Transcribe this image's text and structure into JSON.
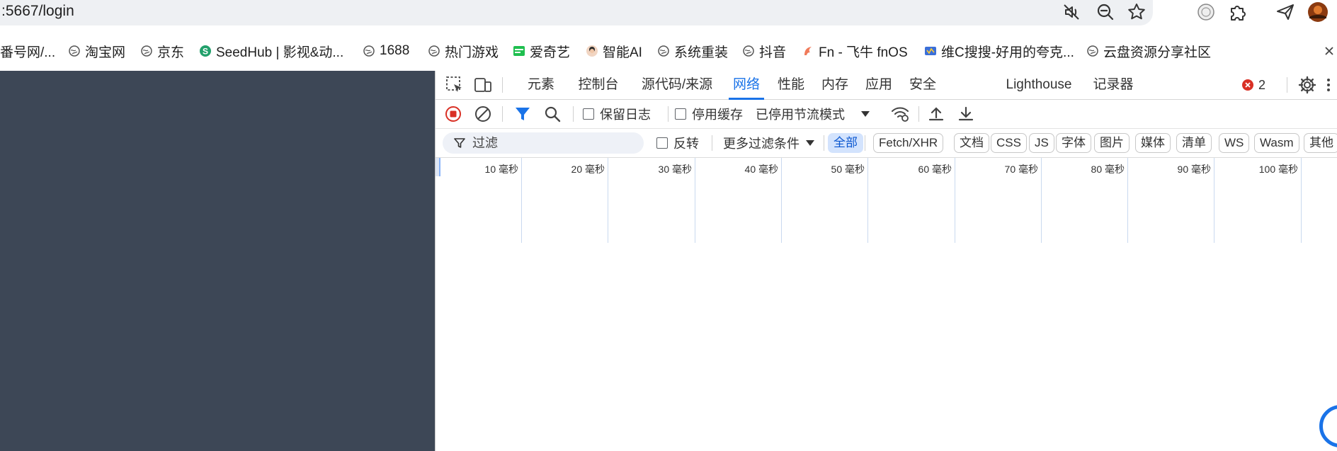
{
  "browser": {
    "url": ":5667/login"
  },
  "bookmarks": [
    {
      "label": "番号网/...",
      "icon": "none"
    },
    {
      "label": "淘宝网",
      "icon": "globe-icon"
    },
    {
      "label": "京东",
      "icon": "globe-icon"
    },
    {
      "label": "SeedHub | 影视&动...",
      "icon": "seedhub-logo-icon"
    },
    {
      "label": "1688",
      "icon": "globe-icon"
    },
    {
      "label": "热门游戏",
      "icon": "globe-icon"
    },
    {
      "label": "爱奇艺",
      "icon": "iqiyi-logo-icon"
    },
    {
      "label": "智能AI",
      "icon": "avatar-icon"
    },
    {
      "label": "系统重装",
      "icon": "globe-icon"
    },
    {
      "label": "抖音",
      "icon": "globe-icon"
    },
    {
      "label": "Fn - 飞牛 fnOS",
      "icon": "fnos-logo-icon"
    },
    {
      "label": "维C搜搜-好用的夸克...",
      "icon": "vc-logo-icon"
    },
    {
      "label": "云盘资源分享社区",
      "icon": "globe-icon"
    }
  ],
  "devtools": {
    "tabs": [
      "元素",
      "控制台",
      "源代码/来源",
      "网络",
      "性能",
      "内存",
      "应用",
      "安全",
      "Lighthouse",
      "记录器"
    ],
    "active_tab": "网络",
    "error_count": "2",
    "toolbar": {
      "preserve_log": "保留日志",
      "disable_cache": "停用缓存",
      "throttling": "已停用节流模式"
    },
    "filter": {
      "placeholder": "过滤",
      "invert": "反转",
      "more_filters": "更多过滤条件"
    },
    "type_chips": [
      "全部",
      "Fetch/XHR",
      "文档",
      "CSS",
      "JS",
      "字体",
      "图片",
      "媒体",
      "清单",
      "WS",
      "Wasm",
      "其他"
    ],
    "timeline_ticks": [
      "10 毫秒",
      "20 毫秒",
      "30 毫秒",
      "40 毫秒",
      "50 毫秒",
      "60 毫秒",
      "70 毫秒",
      "80 毫秒",
      "90 毫秒",
      "100 毫秒"
    ]
  },
  "colors": {
    "accent": "#1a73e8",
    "page_background": "#3d4756",
    "record_red": "#d93025"
  }
}
